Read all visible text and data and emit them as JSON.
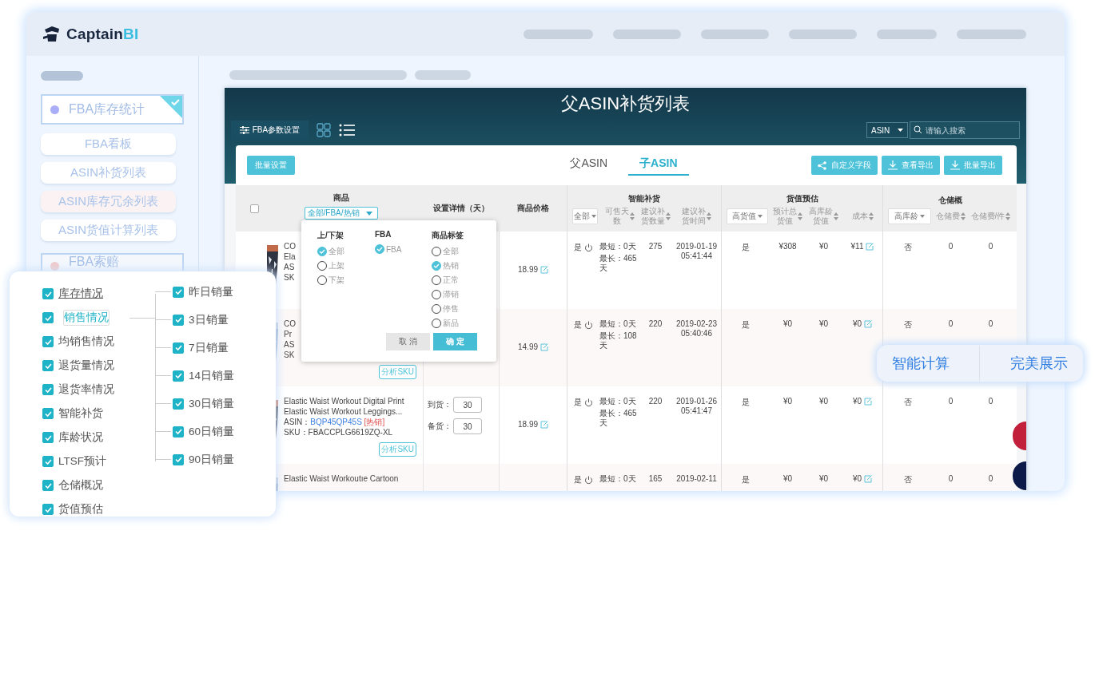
{
  "logo": {
    "name": "Captain",
    "accent": "BI"
  },
  "sidebar": {
    "groups": [
      {
        "label": "FBA库存统计",
        "selected": true,
        "items": [
          {
            "label": "FBA看板",
            "hovered": false
          },
          {
            "label": "ASIN补货列表",
            "hovered": false
          },
          {
            "label": "ASIN库存冗余列表",
            "hovered": true
          },
          {
            "label": "ASIN货值计算列表",
            "hovered": false
          }
        ]
      },
      {
        "label": "FBA索赔",
        "selected": false
      }
    ]
  },
  "app": {
    "title": "父ASIN补货列表",
    "settings_button": "FBA参数设置",
    "search": {
      "scope": "ASIN",
      "placeholder": "请输入搜索"
    },
    "batch_button": "批量设置",
    "tabs": [
      {
        "label": "父ASIN",
        "selected": false
      },
      {
        "label": "子ASIN",
        "selected": true
      }
    ],
    "actions": [
      {
        "label": "自定义字段",
        "kind": "share"
      },
      {
        "label": "查看导出",
        "kind": "download"
      },
      {
        "label": "批量导出",
        "kind": "download"
      }
    ],
    "table": {
      "select_all": {
        "checked": false
      },
      "product_header": "商品",
      "product_filter": "全部/FBA/热销",
      "settings_header": "设置详情（天）",
      "price_header": "商品价格",
      "groups": [
        {
          "title": "智能补货",
          "filter": "全部",
          "columns": [
            "可售天数",
            "建议补货数量",
            "建议补货时间"
          ]
        },
        {
          "title": "货值预估",
          "filter": "高货值",
          "columns": [
            "预计总货值",
            "高库龄货值",
            "成本"
          ]
        },
        {
          "title": "仓储概",
          "filter": "高库龄",
          "columns": [
            "仓储费",
            "仓储费/件"
          ]
        }
      ],
      "rows": [
        {
          "product": {
            "lines": [
              "CO",
              "Ela",
              "AS",
              "SK"
            ]
          },
          "price": "18.99",
          "smart": {
            "flag": "是",
            "range": [
              "最短：0天",
              "最长：465天"
            ],
            "qty": "275",
            "time": "2019-01-19 05:41:44"
          },
          "value": {
            "flag": "是",
            "total": "¥308",
            "aged": "¥0",
            "cost": "¥11"
          },
          "storage": {
            "flag": "否",
            "fee": "0",
            "per_unit": "0"
          }
        },
        {
          "product": {
            "lines": [
              "CO",
              "Pr",
              "AS",
              "SK"
            ],
            "analyze": "分析SKU"
          },
          "price": "14.99",
          "smart": {
            "flag": "是",
            "range": [
              "最短：0天",
              "最长：108天"
            ],
            "qty": "220",
            "time": "2019-02-23 05:40:46"
          },
          "value": {
            "flag": "是",
            "total": "¥0",
            "aged": "¥0",
            "cost": "¥0"
          },
          "storage": {
            "flag": "否",
            "fee": "0",
            "per_unit": "0"
          }
        },
        {
          "product": {
            "lines": [
              "Elastic Waist Workout Digital Print",
              "Elastic Waist Workout Leggings..."
            ],
            "asin_label": "ASIN：",
            "asin": "BQP45QP45S",
            "tag": "[热销]",
            "sku": "SKU：FBACCPLG6619ZQ-XL",
            "analyze": "分析SKU"
          },
          "settings": [
            {
              "label": "到货：",
              "value": "30"
            },
            {
              "label": "备货：",
              "value": "30"
            }
          ],
          "price": "18.99",
          "smart": {
            "flag": "是",
            "range": [
              "最短：0天",
              "最长：465天"
            ],
            "qty": "220",
            "time": "2019-01-26 05:41:47"
          },
          "value": {
            "flag": "是",
            "total": "¥0",
            "aged": "¥0",
            "cost": "¥0"
          },
          "storage": {
            "flag": "否",
            "fee": "0",
            "per_unit": "0"
          }
        },
        {
          "product": {
            "lines": [
              "Elastic Waist Workoutıe Cartoon"
            ]
          },
          "smart": {
            "flag": "是",
            "range": [
              "最短：0天"
            ],
            "qty": "165",
            "time": "2019-02-11"
          },
          "value": {
            "flag": "是",
            "total": "¥0",
            "aged": "¥0",
            "cost": "¥0"
          },
          "storage": {
            "flag": "否",
            "fee": "0",
            "per_unit": "0"
          }
        }
      ]
    },
    "filter_popup": {
      "columns": [
        {
          "title": "上/下架",
          "options": [
            {
              "label": "全部",
              "selected": true
            },
            {
              "label": "上架",
              "selected": false
            },
            {
              "label": "下架",
              "selected": false
            }
          ]
        },
        {
          "title": "FBA",
          "options": [
            {
              "label": "FBA",
              "selected": true
            }
          ]
        },
        {
          "title": "商品标签",
          "options": [
            {
              "label": "全部",
              "selected": false
            },
            {
              "label": "热销",
              "selected": true
            },
            {
              "label": "正常",
              "selected": false
            },
            {
              "label": "滞销",
              "selected": false
            },
            {
              "label": "停售",
              "selected": false
            },
            {
              "label": "新品",
              "selected": false
            }
          ]
        }
      ],
      "cancel": "取 消",
      "confirm": "确 定"
    }
  },
  "panel": {
    "fields": [
      {
        "label": "库存情况",
        "checked": true,
        "selected": false,
        "hovered": true
      },
      {
        "label": "销售情况",
        "checked": true,
        "selected": true,
        "hovered": false
      },
      {
        "label": "均销售情况",
        "checked": true,
        "selected": false,
        "hovered": false
      },
      {
        "label": "退货量情况",
        "checked": true,
        "selected": false,
        "hovered": false
      },
      {
        "label": "退货率情况",
        "checked": true,
        "selected": false,
        "hovered": false
      },
      {
        "label": "智能补货",
        "checked": true,
        "selected": false,
        "hovered": false
      },
      {
        "label": "库龄状况",
        "checked": true,
        "selected": false,
        "hovered": false
      },
      {
        "label": "LTSF预计",
        "checked": true,
        "selected": false,
        "hovered": false
      },
      {
        "label": "仓储概况",
        "checked": true,
        "selected": false,
        "hovered": false
      },
      {
        "label": "货值预估",
        "checked": true,
        "selected": false,
        "hovered": false
      }
    ],
    "sub_fields": [
      {
        "label": "昨日销量",
        "checked": true
      },
      {
        "label": "3日销量",
        "checked": true
      },
      {
        "label": "7日销量",
        "checked": true
      },
      {
        "label": "14日销量",
        "checked": true
      },
      {
        "label": "30日销量",
        "checked": true
      },
      {
        "label": "60日销量",
        "checked": true
      },
      {
        "label": "90日销量",
        "checked": true
      }
    ]
  },
  "badge": {
    "items": [
      "智能计算",
      "完美展示"
    ]
  }
}
